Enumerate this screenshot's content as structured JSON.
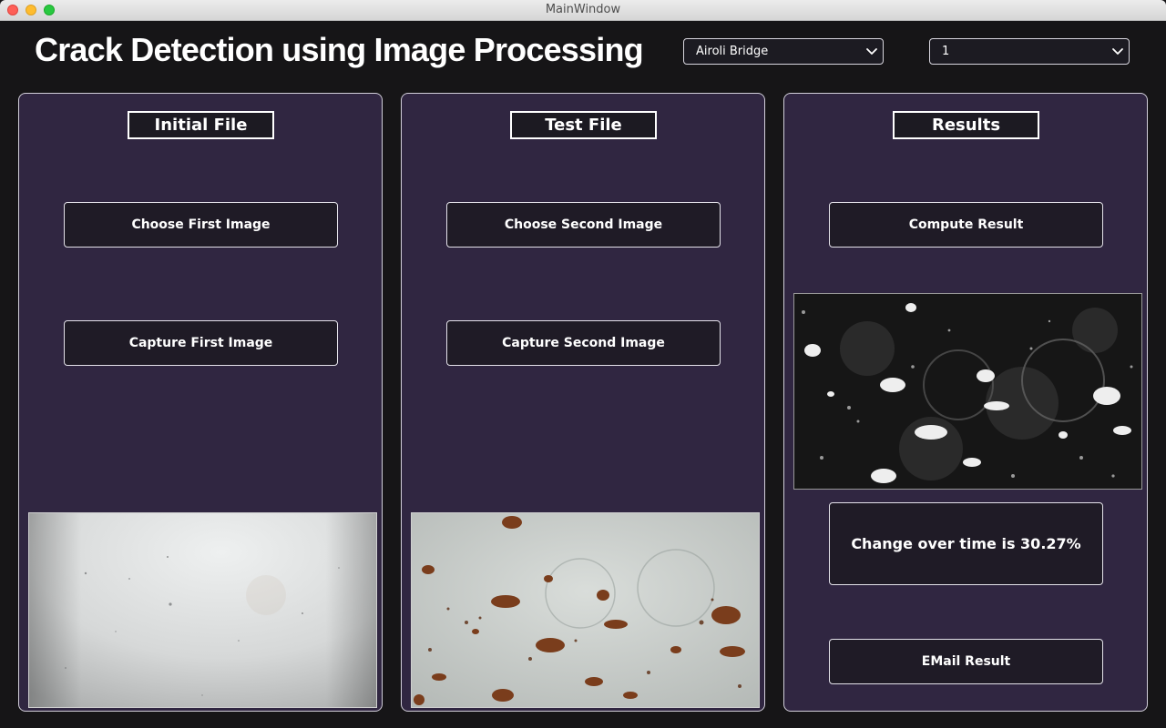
{
  "window": {
    "title": "MainWindow"
  },
  "header": {
    "title": "Crack Detection using Image Processing",
    "bridge_select": {
      "value": "Airoli Bridge"
    },
    "index_select": {
      "value": "1"
    }
  },
  "initial_panel": {
    "heading": "Initial File",
    "choose_label": "Choose First Image",
    "capture_label": "Capture First Image"
  },
  "test_panel": {
    "heading": "Test File",
    "choose_label": "Choose Second Image",
    "capture_label": "Capture Second Image"
  },
  "results_panel": {
    "heading": "Results",
    "compute_label": "Compute Result",
    "change_text": "Change over time is 30.27%",
    "email_label": "EMail Result"
  },
  "colors": {
    "background": "#161517",
    "panel": "#302641",
    "button": "#1f1b26"
  }
}
